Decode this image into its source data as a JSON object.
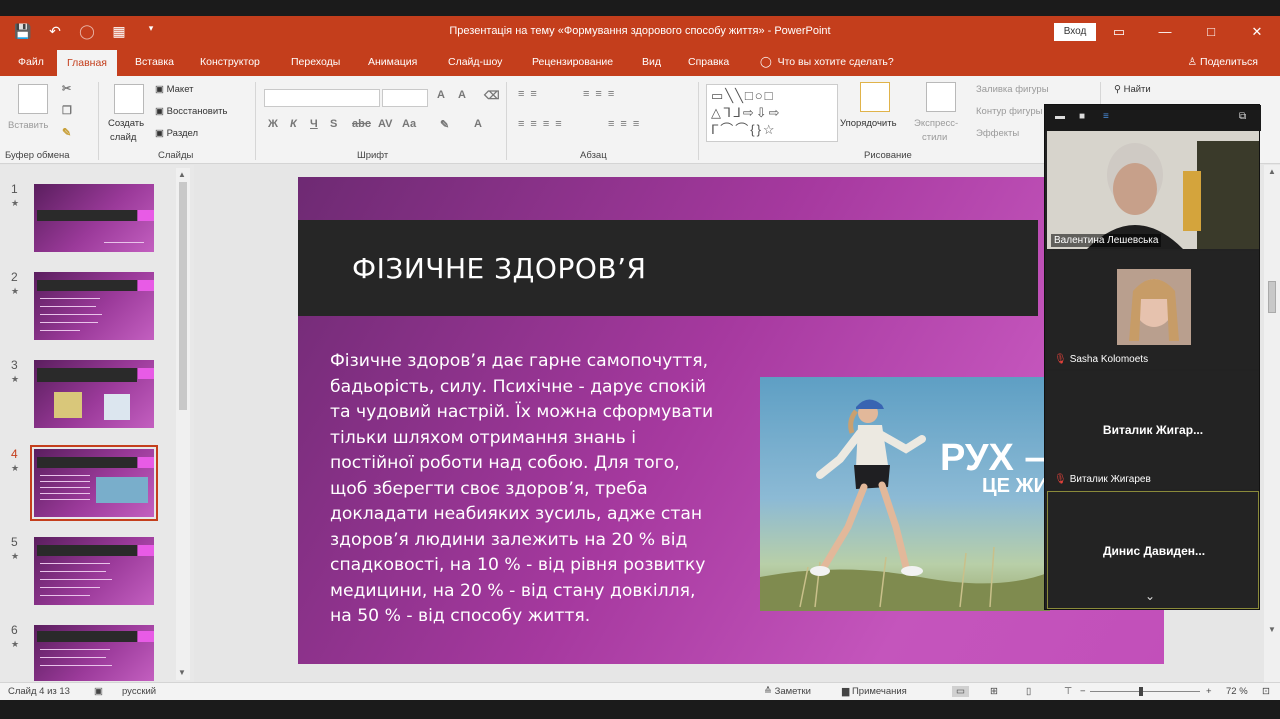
{
  "window": {
    "title": "Презентація на тему «Формування здорового способу життя» - PowerPoint",
    "signin_label": "Вход",
    "qat": [
      "save-icon",
      "undo-icon",
      "redo-icon",
      "presentation-icon",
      "customize-icon"
    ],
    "buttons": [
      "—",
      "▭",
      "□",
      "✕"
    ]
  },
  "tabs": [
    "Файл",
    "Главная",
    "Вставка",
    "Конструктор",
    "Переходы",
    "Анимация",
    "Слайд-шоу",
    "Рецензирование",
    "Вид",
    "Справка"
  ],
  "active_tab": "Главная",
  "tell_me": "Что вы хотите сделать?",
  "share_label": "Поделиться",
  "ribbon": {
    "clipboard": {
      "paste": "Вставить",
      "label": "Буфер обмена"
    },
    "slides": {
      "new_slide": "Создать",
      "new_slide2": "слайд",
      "layout": "Макет",
      "reset": "Восстановить",
      "section": "Раздел",
      "label": "Слайды"
    },
    "font": {
      "label": "Шрифт"
    },
    "paragraph": {
      "label": "Абзац"
    },
    "drawing": {
      "arrange": "Упорядочить",
      "quick_styles": "Экспресс-",
      "quick_styles2": "стили",
      "shape_fill": "Заливка фигуры",
      "shape_outline": "Контур фигуры",
      "shape_effects": "Эффекты",
      "label": "Рисование"
    },
    "editing": {
      "find": "Найти"
    }
  },
  "thumbnails": [
    {
      "num": "1"
    },
    {
      "num": "2"
    },
    {
      "num": "3"
    },
    {
      "num": "4",
      "active": true
    },
    {
      "num": "5"
    },
    {
      "num": "6"
    }
  ],
  "slide": {
    "title": "ФІЗИЧНЕ ЗДОРОВ’Я",
    "body_lines": [
      "Фізичне здоров’я дає гарне самопочуття,",
      "бадьорість, силу. Психічне - дарує спокій",
      "та чудовий настрій. Їх можна сформувати",
      "тільки шляхом отримання знань і",
      "постійної роботи над собою. Для того,",
      "щоб зберегти своє здоров’я, треба",
      "докладати неабияких зусиль, адже стан",
      "здоров’я людини залежить на 20 % від",
      "спадковості, на 10 % - від рівня розвитку",
      "медицини, на 20 % - від стану довкілля,",
      "на 50 % - від способу життя."
    ],
    "photo_text_1": "РУХ –",
    "photo_text_2": "ЦЕ ЖИТ"
  },
  "video_panel": {
    "participants": [
      {
        "name": "Валентина Лешевська"
      },
      {
        "name": "Sasha Kolomoets"
      },
      {
        "display": "Виталик  Жигар...",
        "name": "Виталик Жигарев"
      },
      {
        "display": "Динис  Давиден..."
      }
    ]
  },
  "status": {
    "slide_info": "Слайд 4 из 13",
    "language": "русский",
    "notes": "Заметки",
    "comments": "Примечания",
    "zoom": "72 %"
  }
}
